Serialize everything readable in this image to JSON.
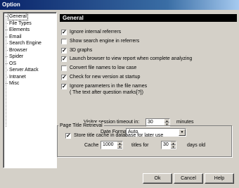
{
  "window": {
    "title": "Option"
  },
  "tree": {
    "items": [
      "General",
      "File Types",
      "Elements",
      "Email",
      "Search Engine",
      "Browser",
      "Spider",
      "OS",
      "Server Attack",
      "Intranet",
      "Misc"
    ],
    "selected": "General"
  },
  "panel": {
    "header": "General",
    "options": [
      {
        "label": "Ignore internal referrers",
        "checked": true
      },
      {
        "label": "Show search engine in referrers",
        "checked": false
      },
      {
        "label": "3D graphs",
        "checked": true
      },
      {
        "label": "Launch browser to view report when complete analyzing",
        "checked": true
      },
      {
        "label": "Convert file names to low case",
        "checked": false
      },
      {
        "label": "Check for new version at startup",
        "checked": true
      },
      {
        "label": "Ignore parameters in the file names",
        "sublabel": "( The text after question marks[?])",
        "checked": true
      }
    ],
    "timeout": {
      "label": "Visitor session timeout in:",
      "value": "30",
      "unit": "minutes"
    },
    "date_format": {
      "label": "Date Format:",
      "value": "Auto"
    },
    "page_title": {
      "group_label": "Page Title Retrieval",
      "store_label": "Store title cache in database for later use",
      "store_checked": true,
      "cache_label": "Cache",
      "cache_value": "1000",
      "titles_for_label": "titles for",
      "days_value": "30",
      "days_old_label": "days old"
    }
  },
  "buttons": {
    "ok": "Ok",
    "cancel": "Cancel",
    "help": "Help"
  }
}
